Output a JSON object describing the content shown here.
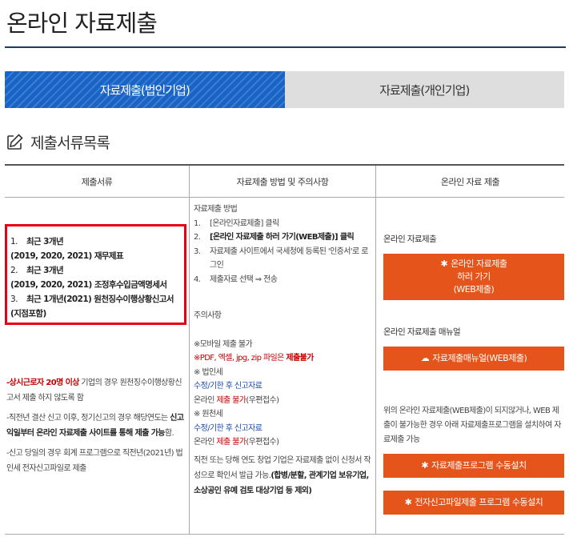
{
  "page": {
    "title": "온라인 자료제출"
  },
  "tabs": [
    {
      "label": "자료제출(법인기업)",
      "active": true
    },
    {
      "label": "자료제출(개인기업)",
      "active": false
    }
  ],
  "section": {
    "title": "제출서류목록"
  },
  "table": {
    "headers": [
      "제출서류",
      "자료제출 방법 및 주의사항",
      "온라인 자료 제출"
    ],
    "documents": [
      {
        "num": "1.",
        "line1": "최근 3개년",
        "line2": "(2019, 2020, 2021) 재무제표"
      },
      {
        "num": "2.",
        "line1": "최근 3개년",
        "line2": "(2019, 2020, 2021) 조정후수입금액명세서"
      },
      {
        "num": "3.",
        "line1": "최근 1개년(2021) 원천징수이행상황신고서",
        "line2": "(지점포함)"
      }
    ],
    "notes": {
      "n1_red": "-상시근로자 20명 이상",
      "n1_rest": " 기업의 경우 원천징수이행상황신고서 제출 하지 않도록 함",
      "n2_pre": "-직전년 결산 신고 이후, 정기신고의 경우 해당연도는 ",
      "n2_bold": "신고 익일부터 온라인 자료제출 사이트를 통해 제출 가능",
      "n2_post": "함.",
      "n3": "-신고 당일의 경우 회계 프로그램으로 직전년(2021년) 법인세 전자신고파일로 제출"
    },
    "method": {
      "heading": "자료제출 방법",
      "steps": [
        {
          "n": "1.",
          "text": "[온라인자료제출] 클릭",
          "bold": false
        },
        {
          "n": "2.",
          "text": "[온라인 자료제출 하러 가기(WEB제출)] 클릭",
          "bold": true
        },
        {
          "n": "3.",
          "text": "자료제출 사이트에서 국세청에 등록된 '인증서'로 로그인",
          "bold": false
        },
        {
          "n": "4.",
          "text": "제출자료 선택 ⇒ 전송",
          "bold": false
        }
      ],
      "caution_heading": "주의사항",
      "mobile": "※모바일 제출 불가",
      "filetype_pre": "※PDF, 엑셀, jpg, zip 파일은 ",
      "filetype_red": "제출불가",
      "corp_tax": "※ 법인세",
      "corp_tax_blue": "수정/기한 후 신고자료",
      "online_pre": "온라인 ",
      "online_red": "제출 불가",
      "online_post": "(우편접수)",
      "withholding": "※ 원천세",
      "withholding_blue": "수정/기한 후 신고자료",
      "closing_pre": "직전 또는 당해 연도 창업 기업은 자료제출 없이 신청서 작성으로 확인서 발급 가능.",
      "closing_bold": "(합병/분할, 관계기업 보유기업, 소상공인 유예 검토 대상기업 등 제외)"
    },
    "online": {
      "label1": "온라인 자료제출",
      "btn_submit_l1": "온라인 자료제출",
      "btn_submit_l2": "하러 가기",
      "btn_submit_l3": "(WEB제출)",
      "label2": "온라인 자료제출 매뉴얼",
      "btn_manual": "자료제출매뉴얼(WEB제출)",
      "note": "위의 온라인 자료제출(WEB제출)이 되지않거나, WEB 제출이 불가능한 경우 아래 자료제출프로그램을 설치하여 자료제출 가능",
      "btn_program": "자료제출프로그램 수동설치",
      "btn_efile": "전자신고파일제출 프로그램 수동설치"
    }
  },
  "colors": {
    "accent": "#1863c6",
    "button": "#e4541b",
    "highlight_border": "#e60012"
  }
}
